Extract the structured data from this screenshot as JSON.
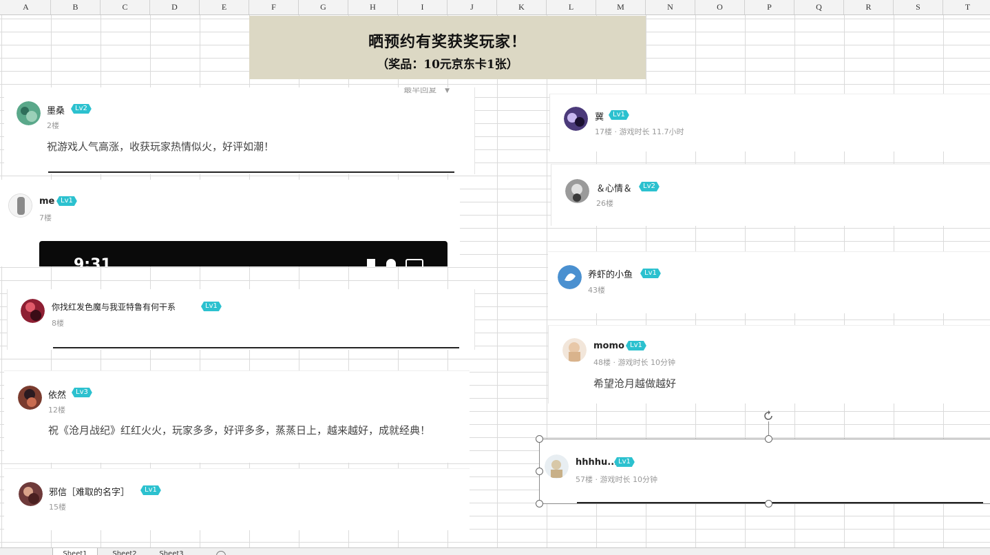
{
  "columns": [
    "A",
    "B",
    "C",
    "D",
    "E",
    "F",
    "G",
    "H",
    "I",
    "J",
    "K",
    "L",
    "M",
    "N",
    "O",
    "P",
    "Q",
    "R",
    "S",
    "T"
  ],
  "banner": {
    "title": "晒预约有奖获奖玩家！",
    "subtitle": "（奖品：10元京东卡1张）"
  },
  "left_cards": [
    {
      "username": "墨桑",
      "level": "Lv2",
      "floor": "2楼",
      "comment": "祝游戏人气高涨，收获玩家热情似火，好评如潮！",
      "sort_label": "最早回复",
      "avatar_color": "#5aa88a"
    },
    {
      "username": "me",
      "level": "Lv1",
      "floor": "7楼",
      "image_time": "9:31",
      "avatar_color": "#b9b9b9"
    },
    {
      "username": "你找红发色魔与我亚特鲁有何干系",
      "level": "Lv1",
      "floor": "8楼",
      "avatar_color": "#8e1f33"
    },
    {
      "username": "依然",
      "level": "Lv3",
      "floor": "12楼",
      "comment": "祝《沧月战纪》红红火火，玩家多多，好评多多，蒸蒸日上，越来越好，成就经典！",
      "avatar_color": "#7a3b2e"
    },
    {
      "username": "邪信［难取的名字］",
      "level": "Lv1",
      "floor": "15楼",
      "avatar_color": "#6e3a3a"
    }
  ],
  "right_cards": [
    {
      "username": "冀",
      "level": "Lv1",
      "floor_meta": "17楼 · 游戏时长 11.7小时",
      "avatar_color": "#4b3a7a"
    },
    {
      "username": "＆心情＆",
      "level": "Lv2",
      "floor_meta": "26楼",
      "avatar_color": "#9a9a9a"
    },
    {
      "username": "养虾的小鱼",
      "level": "Lv1",
      "floor_meta": "43楼",
      "avatar_color": "#4a90d0"
    },
    {
      "username": "momo",
      "level": "Lv1",
      "floor_meta": "48楼 · 游戏时长 10分钟",
      "comment": "希望沧月越做越好",
      "avatar_color": "#e8d8c8"
    },
    {
      "username": "hhhhu...",
      "level": "Lv1",
      "floor_meta": "57楼 · 游戏时长 10分钟",
      "avatar_color": "#d8c8a8"
    }
  ],
  "sheet_tabs": [
    "Sheet1",
    "Sheet2",
    "Sheet3"
  ],
  "colors": {
    "level_badge": "#2cc1cf",
    "banner_bg": "#dcd8c4",
    "grid": "#dadada"
  }
}
